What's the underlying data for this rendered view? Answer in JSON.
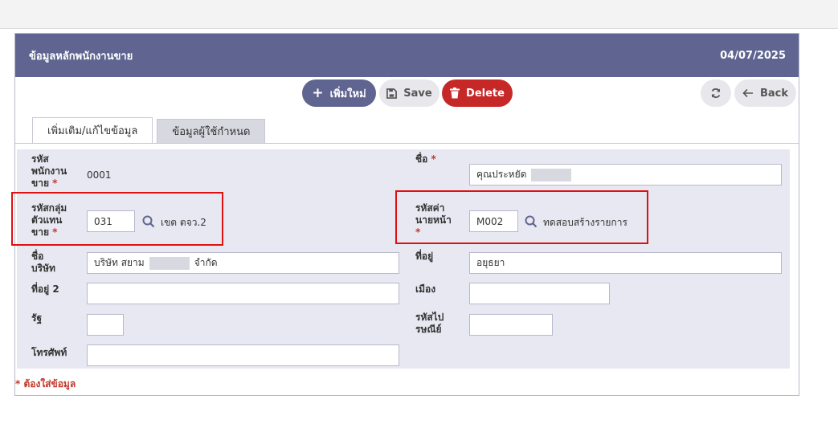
{
  "header": {
    "title": "ข้อมูลหลักพนักงานขาย",
    "date": "04/07/2025"
  },
  "toolbar": {
    "add_label": "เพิ่มใหม่",
    "save_label": "Save",
    "delete_label": "Delete",
    "back_label": "Back"
  },
  "tabs": [
    {
      "label": "เพิ่มเติม/แก้ไขข้อมูล"
    },
    {
      "label": "ข้อมูลผู้ใช้กำหนด"
    }
  ],
  "form": {
    "emp_code": {
      "label_lines": [
        "รหัส",
        "พนักงาน",
        "ขาย"
      ],
      "value": "0001"
    },
    "name": {
      "label": "ชื่อ",
      "value": "คุณประหยัด"
    },
    "rep_group": {
      "label_lines": [
        "รหัสกลุ่ม",
        "ตัวแทน",
        "ขาย"
      ],
      "value": "031",
      "desc": "เขต ตจว.2"
    },
    "vendor_code": {
      "label_lines": [
        "รหัสค่า",
        "นายหน้า"
      ],
      "value": "M002",
      "desc": "ทดสอบสร้างรายการ"
    },
    "company": {
      "label_lines": [
        "ชื่อ",
        "บริษัท"
      ],
      "value_prefix": "บริษัท สยาม",
      "value_suffix": "จำกัด"
    },
    "address": {
      "label": "ที่อยู่",
      "value": "อยุธยา"
    },
    "address2": {
      "label": "ที่อยู่ 2",
      "value": ""
    },
    "city": {
      "label": "เมือง",
      "value": ""
    },
    "state": {
      "label": "รัฐ",
      "value": ""
    },
    "postal": {
      "label_lines": [
        "รหัสไป",
        "รษณีย์"
      ],
      "value": ""
    },
    "phone": {
      "label": "โทรศัพท์",
      "value": ""
    }
  },
  "footnote": "* ต้องใส่ข้อมูล",
  "colors": {
    "header_bg": "#5f6590",
    "delete_red": "#c62828",
    "required_red": "#c0392b",
    "form_bg": "#e8e8f2"
  }
}
